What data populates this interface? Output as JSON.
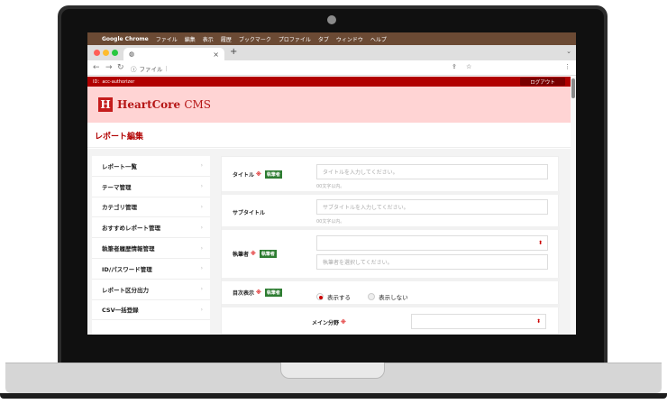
{
  "mac_menu": {
    "app": "Google Chrome",
    "items": [
      "ファイル",
      "編集",
      "表示",
      "履歴",
      "ブックマーク",
      "プロファイル",
      "タブ",
      "ウィンドウ",
      "ヘルプ"
    ]
  },
  "browser": {
    "new_tab": "+",
    "address_label": "ファイル",
    "address_value": ""
  },
  "cms": {
    "user_bar": "ID：acc-authorizer",
    "logout": "ログアウト",
    "logo_text": "HeartCore",
    "logo_suffix": "CMS",
    "page_title": "レポート編集"
  },
  "sidebar": {
    "items": [
      {
        "label": "レポート一覧"
      },
      {
        "label": "テーマ管理"
      },
      {
        "label": "カテゴリ管理"
      },
      {
        "label": "おすすめレポート管理"
      },
      {
        "label": "執筆者履歴情報管理"
      },
      {
        "label": "ID/パスワード管理"
      },
      {
        "label": "レポート区分出力"
      },
      {
        "label": "CSV一括登録"
      }
    ]
  },
  "form": {
    "required_mark": "※",
    "badge": "執筆者",
    "title": {
      "label": "タイトル",
      "placeholder": "タイトルを入力してください。",
      "hint": "00文字以内。"
    },
    "subtitle": {
      "label": "サブタイトル",
      "placeholder": "サブタイトルを入力してください。",
      "hint": "00文字以内。"
    },
    "author": {
      "label": "執筆者",
      "placeholder": "執筆者を選択してください。"
    },
    "toc": {
      "label": "目次表示",
      "options": [
        "表示する",
        "表示しない"
      ],
      "selected": "表示する"
    },
    "main_category": {
      "label": "メイン分野"
    }
  },
  "colors": {
    "brand_red": "#b10000",
    "header_pink": "#ffd4d4",
    "badge_green": "#2e7d32"
  }
}
